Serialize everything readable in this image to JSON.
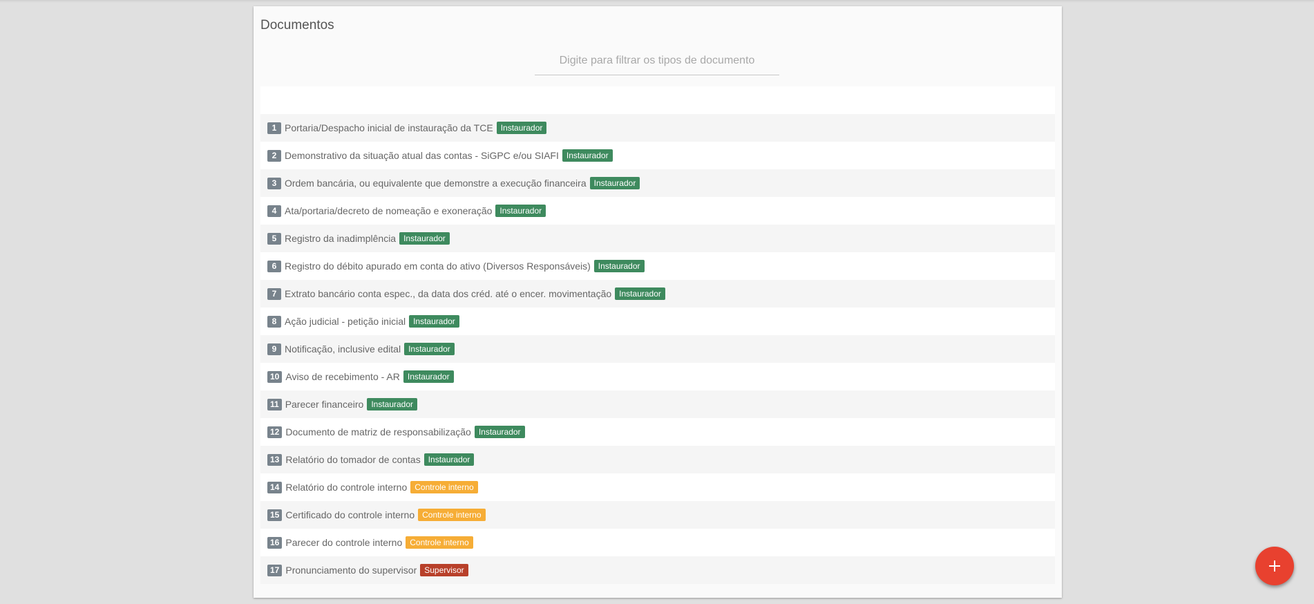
{
  "card": {
    "title": "Documentos"
  },
  "filter": {
    "placeholder": "Digite para filtrar os tipos de documento",
    "value": ""
  },
  "role_colors": {
    "Instaurador": "#3e8a5e",
    "Controle interno": "#f6ad36",
    "Supervisor": "#b8402a"
  },
  "documents": [
    {
      "num": "1",
      "name": "Portaria/Despacho inicial de instauração da TCE",
      "role": "Instaurador"
    },
    {
      "num": "2",
      "name": "Demonstrativo da situação atual das contas - SiGPC e/ou SIAFI",
      "role": "Instaurador"
    },
    {
      "num": "3",
      "name": "Ordem bancária, ou equivalente que demonstre a execução financeira",
      "role": "Instaurador"
    },
    {
      "num": "4",
      "name": "Ata/portaria/decreto de nomeação e exoneração",
      "role": "Instaurador"
    },
    {
      "num": "5",
      "name": "Registro da inadimplência",
      "role": "Instaurador"
    },
    {
      "num": "6",
      "name": "Registro do débito apurado em conta do ativo (Diversos Responsáveis)",
      "role": "Instaurador"
    },
    {
      "num": "7",
      "name": "Extrato bancário conta espec., da data dos créd. até o encer. movimentação",
      "role": "Instaurador"
    },
    {
      "num": "8",
      "name": "Ação judicial - petição inicial",
      "role": "Instaurador"
    },
    {
      "num": "9",
      "name": "Notificação, inclusive edital",
      "role": "Instaurador"
    },
    {
      "num": "10",
      "name": "Aviso de recebimento - AR",
      "role": "Instaurador"
    },
    {
      "num": "11",
      "name": "Parecer financeiro",
      "role": "Instaurador"
    },
    {
      "num": "12",
      "name": "Documento de matriz de responsabilização",
      "role": "Instaurador"
    },
    {
      "num": "13",
      "name": "Relatório do tomador de contas",
      "role": "Instaurador"
    },
    {
      "num": "14",
      "name": "Relatório do controle interno",
      "role": "Controle interno"
    },
    {
      "num": "15",
      "name": "Certificado do controle interno",
      "role": "Controle interno"
    },
    {
      "num": "16",
      "name": "Parecer do controle interno",
      "role": "Controle interno"
    },
    {
      "num": "17",
      "name": "Pronunciamento do supervisor",
      "role": "Supervisor"
    }
  ],
  "fab": {
    "icon": "plus-icon"
  }
}
